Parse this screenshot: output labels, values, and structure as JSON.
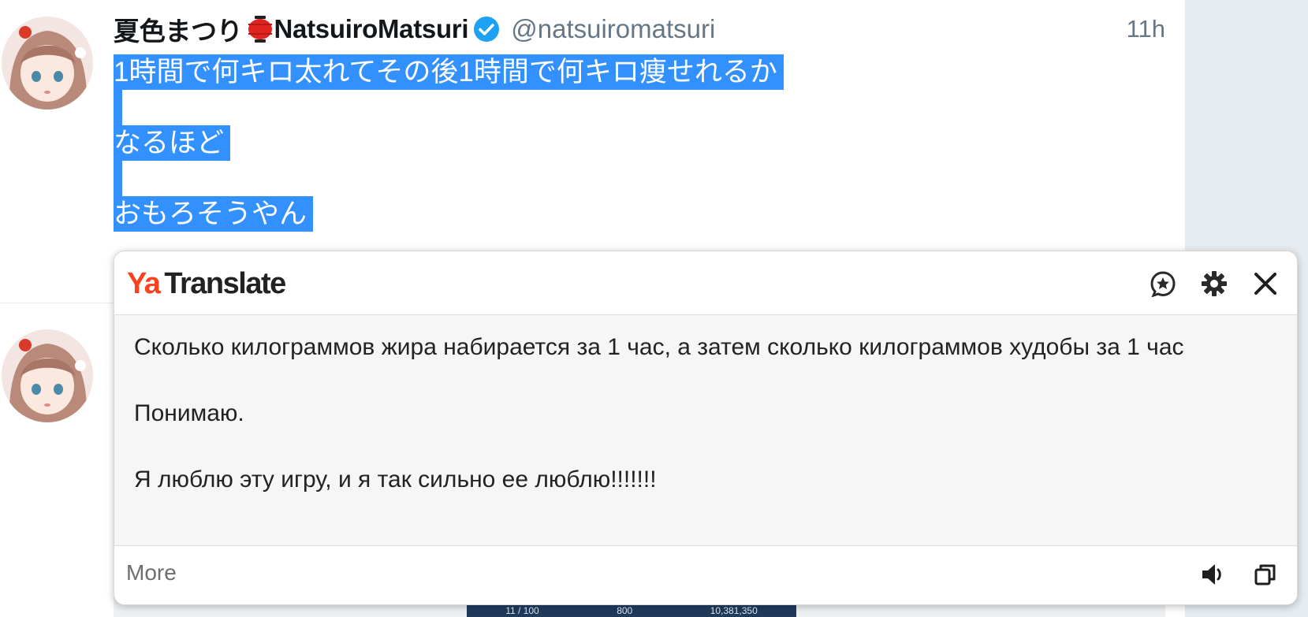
{
  "tweet": {
    "display_name": "夏色まつり",
    "display_name_latin": "NatsuiroMatsuri",
    "handle": "@natsuiromatsuri",
    "timestamp": "11h",
    "lines": [
      "1時間で何キロ太れてその後1時間で何キロ痩せれるか",
      "なるほど",
      "おもろそうやん"
    ],
    "name_emoji": "red-lantern-icon",
    "verified_icon": "verified-badge-icon"
  },
  "translate_popup": {
    "logo_ya": "Ya",
    "logo_text": "Translate",
    "paragraphs": [
      "Сколько килограммов жира набирается за 1 час, а затем сколько килограммов худобы за 1 час",
      "Понимаю.",
      "Я люблю эту игру, и я так сильно ее люблю!!!!!!!"
    ],
    "more_label": "More",
    "icons": {
      "favorite": "star-bubble-icon",
      "settings": "gear-icon",
      "close": "close-icon",
      "speak": "speaker-icon",
      "copy": "copy-icon"
    }
  },
  "media_preview": {
    "stat_1": "11 / 100",
    "stat_2": "800",
    "stat_3": "10,381,350"
  },
  "colors": {
    "selection": "#3390ff",
    "yandex_red": "#fc3f1d",
    "verified_blue": "#1da1f2",
    "secondary_text": "#657786"
  }
}
